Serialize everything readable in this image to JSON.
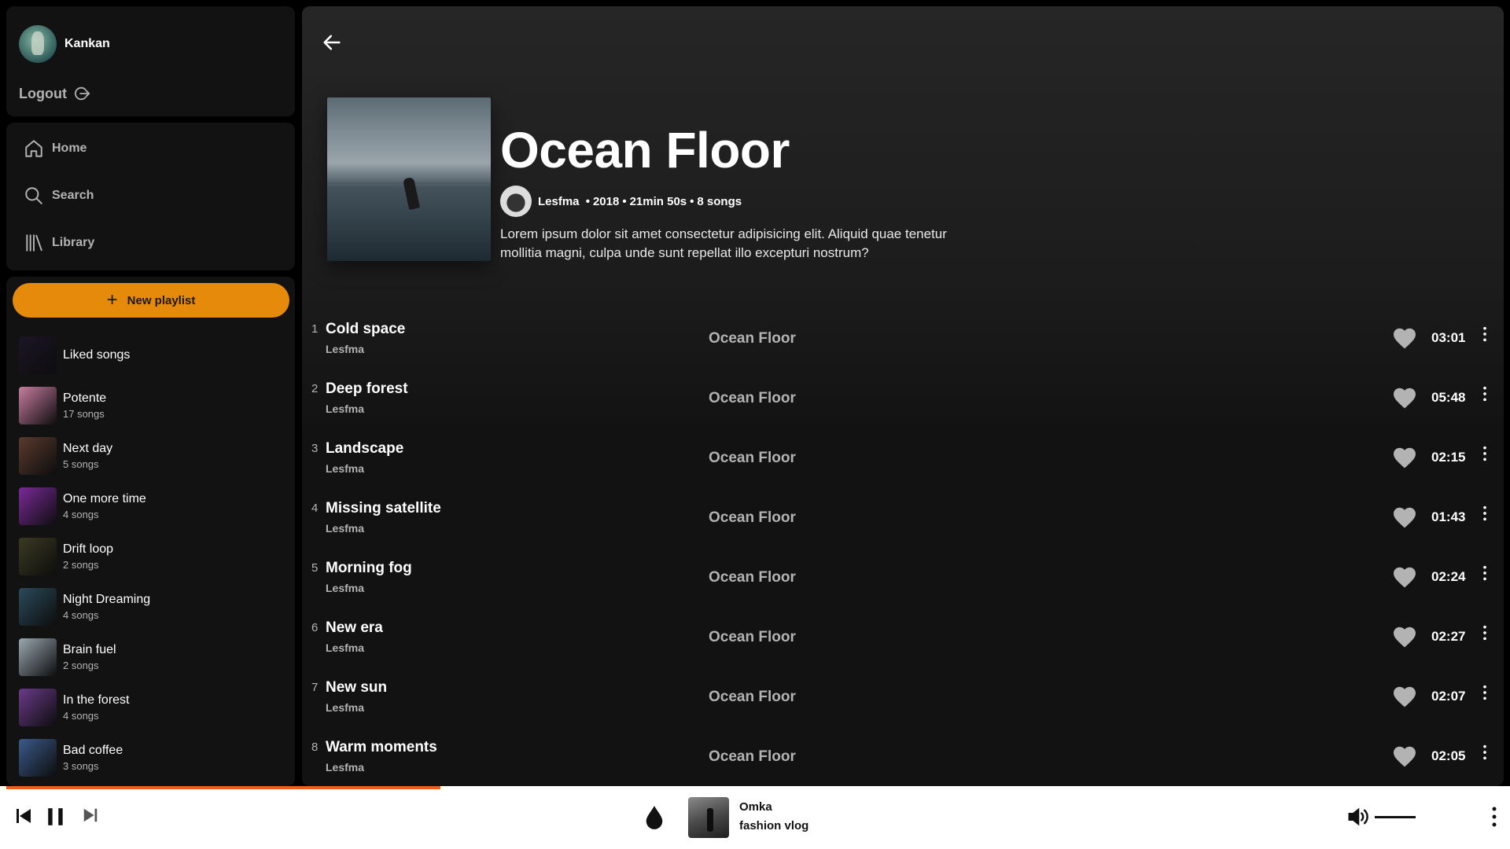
{
  "user": {
    "name": "Kankan",
    "logout_label": "Logout"
  },
  "nav": {
    "home": "Home",
    "search": "Search",
    "library": "Library"
  },
  "library": {
    "new_playlist_label": "New playlist",
    "playlists": [
      {
        "name": "Liked songs",
        "count": "",
        "color": "#1b1526"
      },
      {
        "name": "Potente",
        "count": "17 songs",
        "color": "#c87ca0"
      },
      {
        "name": "Next day",
        "count": "5 songs",
        "color": "#5a3a2e"
      },
      {
        "name": "One more time",
        "count": "4 songs",
        "color": "#7a2a9a"
      },
      {
        "name": "Drift loop",
        "count": "2 songs",
        "color": "#3a3a22"
      },
      {
        "name": "Night Dreaming",
        "count": "4 songs",
        "color": "#2a4a5a"
      },
      {
        "name": "Brain fuel",
        "count": "2 songs",
        "color": "#9aa8b0"
      },
      {
        "name": "In the forest",
        "count": "4 songs",
        "color": "#6a3a8a"
      },
      {
        "name": "Bad coffee",
        "count": "3 songs",
        "color": "#3a5a8a"
      }
    ]
  },
  "album": {
    "title": "Ocean Floor",
    "artist": "Lesfma",
    "year": "2018",
    "duration": "21min 50s",
    "song_count": "8 songs",
    "description": "Lorem ipsum dolor sit amet consectetur adipisicing elit. Aliquid quae tenetur mollitia magni, culpa unde sunt repellat illo excepturi nostrum?"
  },
  "tracks": [
    {
      "num": "1",
      "title": "Cold space",
      "artist": "Lesfma",
      "album": "Ocean Floor",
      "duration": "03:01"
    },
    {
      "num": "2",
      "title": "Deep forest",
      "artist": "Lesfma",
      "album": "Ocean Floor",
      "duration": "05:48"
    },
    {
      "num": "3",
      "title": "Landscape",
      "artist": "Lesfma",
      "album": "Ocean Floor",
      "duration": "02:15"
    },
    {
      "num": "4",
      "title": "Missing satellite",
      "artist": "Lesfma",
      "album": "Ocean Floor",
      "duration": "01:43"
    },
    {
      "num": "5",
      "title": "Morning fog",
      "artist": "Lesfma",
      "album": "Ocean Floor",
      "duration": "02:24"
    },
    {
      "num": "6",
      "title": "New era",
      "artist": "Lesfma",
      "album": "Ocean Floor",
      "duration": "02:27"
    },
    {
      "num": "7",
      "title": "New sun",
      "artist": "Lesfma",
      "album": "Ocean Floor",
      "duration": "02:07"
    },
    {
      "num": "8",
      "title": "Warm moments",
      "artist": "Lesfma",
      "album": "Ocean Floor",
      "duration": "02:05"
    }
  ],
  "player": {
    "now_playing_title": "Omka",
    "now_playing_artist": "fashion vlog",
    "progress": 0.29,
    "accent_color": "#e8601a"
  },
  "colors": {
    "brand": "#e68a0c",
    "background": "#121212"
  }
}
